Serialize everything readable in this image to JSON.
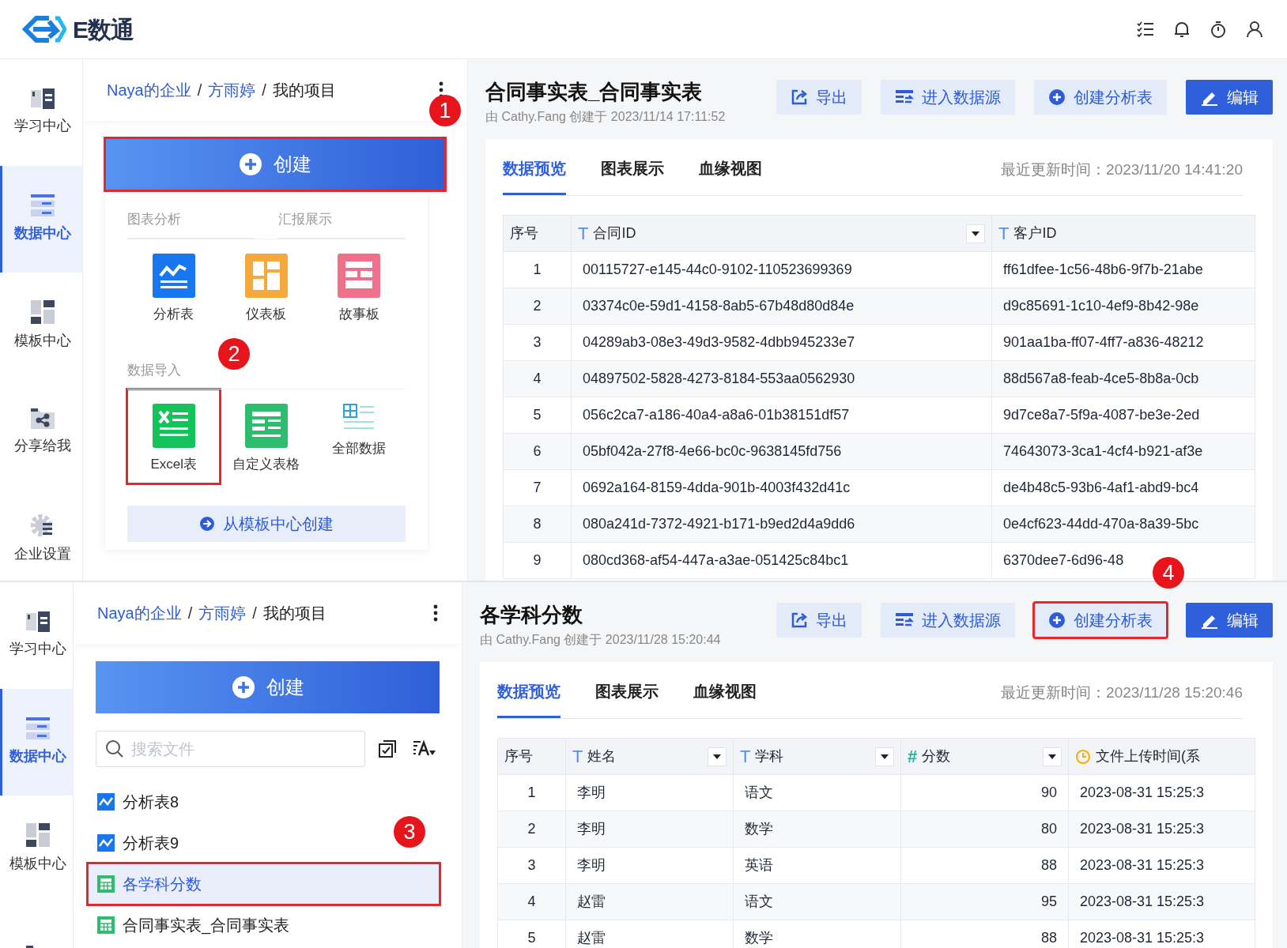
{
  "app": {
    "logo": "E数通"
  },
  "screens": [
    {
      "nav": [
        {
          "kind": "learn",
          "label": "学习中心",
          "selected": false
        },
        {
          "kind": "data",
          "label": "数据中心",
          "selected": true
        },
        {
          "kind": "template",
          "label": "模板中心",
          "selected": false
        },
        {
          "kind": "share",
          "label": "分享给我",
          "selected": false
        },
        {
          "kind": "settings",
          "label": "企业设置",
          "selected": false
        }
      ],
      "breadcrumb": [
        "Naya的企业",
        "方雨婷",
        "我的项目"
      ],
      "breadcrumb_separator": "/",
      "breadcrumb_marker": "1",
      "create_button": {
        "label": "创建",
        "highlighted": true
      },
      "create_menu": {
        "tabs": [
          "图表分析",
          "汇报展示"
        ],
        "items": [
          {
            "kind": "analysis",
            "label": "分析表",
            "highlighted": false
          },
          {
            "kind": "dashboard",
            "label": "仪表板",
            "highlighted": false
          },
          {
            "kind": "story",
            "label": "故事板",
            "highlighted": false
          }
        ],
        "import_title": "数据导入",
        "import_marker": "2",
        "import_items": [
          {
            "kind": "excel",
            "label": "Excel表",
            "highlighted": true
          },
          {
            "kind": "custom",
            "label": "自定义表格",
            "highlighted": false
          },
          {
            "kind": "all",
            "label": "全部数据",
            "highlighted": false
          }
        ],
        "template_button": "从模板中心创建"
      },
      "detail": {
        "title": "合同事实表_合同事实表",
        "meta": "由 Cathy.Fang 创建于 2023/11/14 17:11:52",
        "buttons": [
          {
            "kind": "export",
            "label": "导出",
            "highlighted": false
          },
          {
            "kind": "source",
            "label": "进入数据源",
            "highlighted": false
          },
          {
            "kind": "create",
            "label": "创建分析表",
            "highlighted": false
          },
          {
            "kind": "edit",
            "label": "编辑",
            "highlighted": false
          }
        ],
        "tabs": [
          {
            "label": "数据预览",
            "selected": true
          },
          {
            "label": "图表展示",
            "selected": false
          },
          {
            "label": "血缘视图",
            "selected": false
          }
        ],
        "updated": "最近更新时间：2023/11/20 14:41:20",
        "table": {
          "columns": [
            {
              "label": "序号"
            },
            {
              "kind": "text",
              "glyph": "T",
              "label": "合同ID",
              "filter": true
            },
            {
              "kind": "text",
              "glyph": "T",
              "label": "客户ID",
              "filter": false
            }
          ],
          "rows": [
            [
              "1",
              "00115727-e145-44c0-9102-110523699369",
              "ff61dfee-1c56-48b6-9f7b-21abe"
            ],
            [
              "2",
              "03374c0e-59d1-4158-8ab5-67b48d80d84e",
              "d9c85691-1c10-4ef9-8b42-98e"
            ],
            [
              "3",
              "04289ab3-08e3-49d3-9582-4dbb945233e7",
              "901aa1ba-ff07-4ff7-a836-48212"
            ],
            [
              "4",
              "04897502-5828-4273-8184-553aa0562930",
              "88d567a8-feab-4ce5-8b8a-0cb"
            ],
            [
              "5",
              "056c2ca7-a186-40a4-a8a6-01b38151df57",
              "9d7ce8a7-5f9a-4087-be3e-2ed"
            ],
            [
              "6",
              "05bf042a-27f8-4e66-bc0c-9638145fd756",
              "74643073-3ca1-4cf4-b921-af3e"
            ],
            [
              "7",
              "0692a164-8159-4dda-901b-4003f432d41c",
              "de4b48c5-93b6-4af1-abd9-bc4"
            ],
            [
              "8",
              "080a241d-7372-4921-b171-b9ed2d4a9dd6",
              "0e4cf623-44dd-470a-8a39-5bc"
            ],
            [
              "9",
              "080cd368-af54-447a-a3ae-051425c84bc1",
              "6370dee7-6d96-48"
            ]
          ]
        }
      }
    },
    {
      "nav": [
        {
          "kind": "learn",
          "label": "学习中心",
          "selected": false
        },
        {
          "kind": "data",
          "label": "数据中心",
          "selected": true
        },
        {
          "kind": "template",
          "label": "模板中心",
          "selected": false
        },
        {
          "kind": "share",
          "selected": false
        }
      ],
      "breadcrumb": [
        "Naya的企业",
        "方雨婷",
        "我的项目"
      ],
      "breadcrumb_separator": "/",
      "create_button": {
        "label": "创建",
        "highlighted": false
      },
      "search": {
        "placeholder": "搜索文件"
      },
      "files": [
        {
          "kind": "analysis",
          "label": "分析表8",
          "selected": false
        },
        {
          "kind": "analysis",
          "label": "分析表9",
          "selected": false,
          "marker": "3"
        },
        {
          "kind": "table",
          "label": "各学科分数",
          "selected": true
        },
        {
          "kind": "table",
          "label": "合同事实表_合同事实表",
          "selected": false
        }
      ],
      "detail": {
        "title": "各学科分数",
        "meta": "由 Cathy.Fang 创建于 2023/11/28 15:20:44",
        "buttons": [
          {
            "kind": "export",
            "label": "导出",
            "highlighted": false
          },
          {
            "kind": "source",
            "label": "进入数据源",
            "highlighted": false
          },
          {
            "kind": "create",
            "label": "创建分析表",
            "highlighted": true,
            "marker": "4"
          },
          {
            "kind": "edit",
            "label": "编辑",
            "highlighted": false
          }
        ],
        "tabs": [
          {
            "label": "数据预览",
            "selected": true
          },
          {
            "label": "图表展示",
            "selected": false
          },
          {
            "label": "血缘视图",
            "selected": false
          }
        ],
        "updated": "最近更新时间：2023/11/28 15:20:46",
        "table": {
          "columns": [
            {
              "label": "序号"
            },
            {
              "kind": "text",
              "glyph": "T",
              "label": "姓名",
              "filter": true
            },
            {
              "kind": "text",
              "glyph": "T",
              "label": "学科",
              "filter": true
            },
            {
              "kind": "number",
              "glyph": "#",
              "label": "分数",
              "filter": true
            },
            {
              "kind": "time",
              "label": "文件上传时间(系",
              "filter": false
            }
          ],
          "rows": [
            [
              "1",
              "李明",
              "语文",
              "90",
              "2023-08-31 15:25:3"
            ],
            [
              "2",
              "李明",
              "数学",
              "80",
              "2023-08-31 15:25:3"
            ],
            [
              "3",
              "李明",
              "英语",
              "88",
              "2023-08-31 15:25:3"
            ],
            [
              "4",
              "赵雷",
              "语文",
              "95",
              "2023-08-31 15:25:3"
            ],
            [
              "5",
              "赵雷",
              "数学",
              "88",
              "2023-08-31 15:25:3"
            ]
          ]
        }
      }
    }
  ]
}
